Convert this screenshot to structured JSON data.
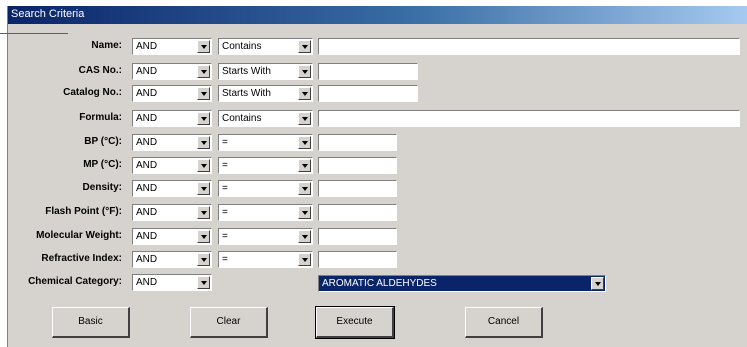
{
  "window": {
    "title": "Search Criteria"
  },
  "rows": [
    {
      "label": "Name:",
      "logic": "AND",
      "op": "Contains",
      "value": ""
    },
    {
      "label": "CAS No.:",
      "logic": "AND",
      "op": "Starts With",
      "value": ""
    },
    {
      "label": "Catalog No.:",
      "logic": "AND",
      "op": "Starts With",
      "value": ""
    },
    {
      "label": "Formula:",
      "logic": "AND",
      "op": "Contains",
      "value": ""
    },
    {
      "label": "BP (°C):",
      "logic": "AND",
      "op": "=",
      "value": ""
    },
    {
      "label": "MP (°C):",
      "logic": "AND",
      "op": "=",
      "value": ""
    },
    {
      "label": "Density:",
      "logic": "AND",
      "op": "=",
      "value": ""
    },
    {
      "label": "Flash Point (°F):",
      "logic": "AND",
      "op": "=",
      "value": ""
    },
    {
      "label": "Molecular Weight:",
      "logic": "AND",
      "op": "=",
      "value": ""
    },
    {
      "label": "Refractive Index:",
      "logic": "AND",
      "op": "=",
      "value": ""
    }
  ],
  "category": {
    "label": "Chemical Category:",
    "logic": "AND",
    "selected": "AROMATIC ALDEHYDES"
  },
  "buttons": {
    "basic": "Basic",
    "clear": "Clear",
    "execute": "Execute",
    "cancel": "Cancel"
  }
}
